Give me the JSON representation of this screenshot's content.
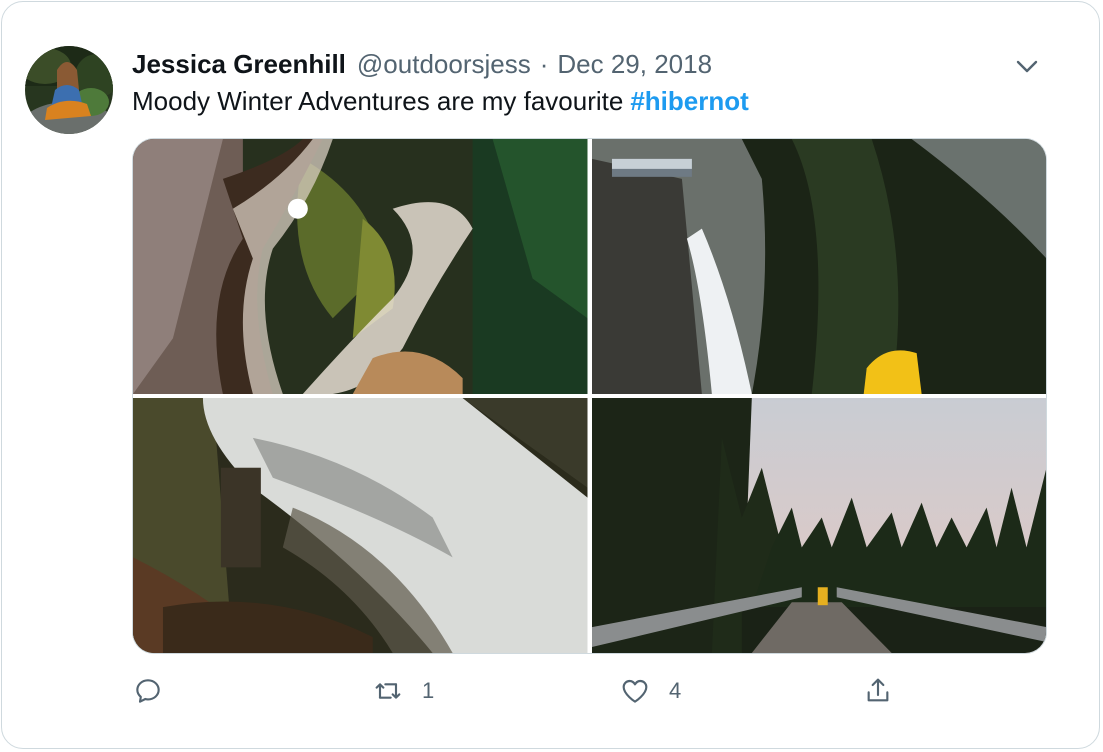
{
  "tweet": {
    "author_name": "Jessica Greenhill",
    "author_handle": "@outdoorsjess",
    "separator": "·",
    "date": "Dec 29, 2018",
    "text": "Moody Winter Adventures are my favourite",
    "hashtag": "#hibernot",
    "retweet_count": "1",
    "like_count": "4"
  },
  "icons": {
    "menu": "chevron-down-icon",
    "reply": "reply-icon",
    "retweet": "retweet-icon",
    "like": "heart-icon",
    "share": "share-icon"
  },
  "colors": {
    "accent": "#1d9bf0",
    "text_primary": "#0f1419",
    "text_secondary": "#536471",
    "border": "#cfd9de"
  }
}
